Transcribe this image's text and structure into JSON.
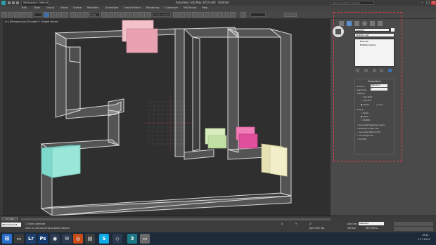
{
  "window": {
    "workspace": "Workspace: Default",
    "app_title": "Autodesk 3ds Max  2014 x64",
    "file_title": "Untitled",
    "search_placeholder": "Type a keyword or phrase"
  },
  "menu": [
    "Edit",
    "Tools",
    "Group",
    "Views",
    "Create",
    "Modifiers",
    "Animation",
    "Graph Editors",
    "Rendering",
    "Customize",
    "MAXScript",
    "Help"
  ],
  "toolbar": {
    "dropdown_view": "View",
    "selection_set": "Create Selection Se"
  },
  "viewport": {
    "label": "[+] [Perspective] [Shaded + Edged Faces]"
  },
  "command_panel": {
    "object_name": "Line001",
    "modifier_list": "Modifier List",
    "stack": [
      "Extrude",
      "Editable Spline"
    ],
    "parameters": {
      "title": "Parameters",
      "amount_label": "Amount:",
      "amount_value": "800,0mm",
      "segments_label": "Segments:",
      "segments_value": "1",
      "capping_label": "Capping",
      "cap_start": "Cap Start",
      "cap_end": "Cap End",
      "morph": "Morph",
      "grid": "Grid",
      "output_label": "Output",
      "patch": "Patch",
      "mesh": "Mesh",
      "nurbs": "NURBS",
      "gen_mapping": "Generate Mapping Coords.",
      "real_world": "Real-World Map Size",
      "gen_material": "Generate Material IDs",
      "use_shape": "Use Shape IDs",
      "smooth": "Smooth"
    }
  },
  "timeline": {
    "frame": "0 / 100"
  },
  "status": {
    "maxscript": "Welcome to M",
    "objects": "1 Object Selected",
    "hint": "Click or click-and-drag to select objects",
    "add_time_tag": "Add Time Tag",
    "auto_key": "Auto Key",
    "set_key": "Set Key",
    "key_mode": "Selected",
    "key_filters": "Key Filters..."
  },
  "coords": {
    "x_label": "X:",
    "x_value": "",
    "y_label": "Y:",
    "y_value": "",
    "z_label": "Z:",
    "z_value": ""
  },
  "taskbar": {
    "time": "19:41",
    "date": "17.7.2014"
  },
  "colors": {
    "selection_dash": "#e53a4b",
    "pink": "#e88aa7",
    "teal": "#7fe0d2",
    "green": "#cfe8b4",
    "magenta": "#e0509a",
    "beige": "#e5e2b0"
  }
}
